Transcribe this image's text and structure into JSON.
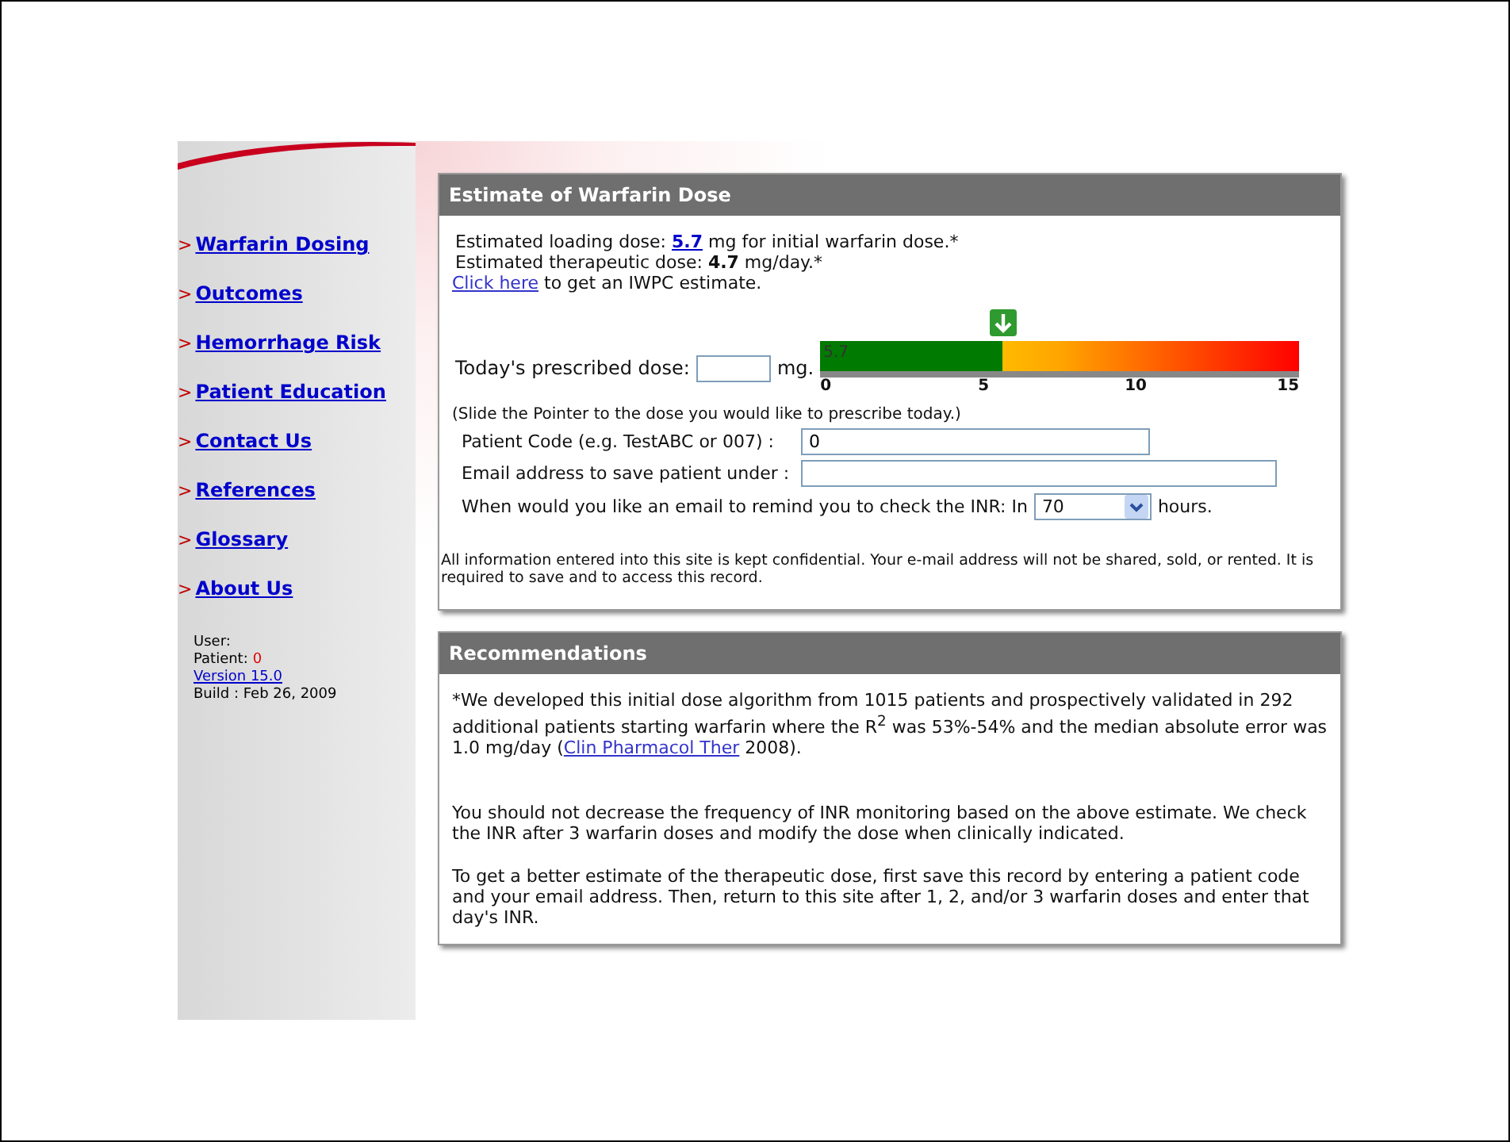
{
  "sidebar": {
    "items": [
      {
        "marker": ">",
        "label": "Warfarin Dosing"
      },
      {
        "marker": ">",
        "label": "Outcomes"
      },
      {
        "marker": ">",
        "label": "Hemorrhage Risk"
      },
      {
        "marker": ">",
        "label": "Patient Education"
      },
      {
        "marker": ">",
        "label": "Contact Us"
      },
      {
        "marker": ">",
        "label": "References"
      },
      {
        "marker": ">",
        "label": "Glossary"
      },
      {
        "marker": ">",
        "label": "About Us"
      }
    ],
    "info": {
      "user": "User:",
      "patient_label": "Patient:",
      "patient_value": "0",
      "version": "Version 15.0",
      "build": "Build : Feb 26, 2009"
    }
  },
  "estimate": {
    "title": "Estimate of Warfarin Dose",
    "loading_prefix": "Estimated loading dose:",
    "loading_value": "5.7",
    "loading_suffix": "mg for initial warfarin dose.*",
    "therapeutic": "Estimated therapeutic dose: **4.7** mg/day.*",
    "iwpc_link": "Click here",
    "iwpc_text": "to get an IWPC estimate.",
    "dose_label": "Today's prescribed dose:",
    "dose_unit": "mg.",
    "meter": {
      "level": 0.38,
      "reading": "5.7",
      "ticks": [
        "0",
        "5",
        "10",
        "15"
      ]
    },
    "hint": "(Slide the Pointer to the dose you would like to prescribe today.)",
    "patient_code_label": "Patient Code (e.g. TestABC or 007) :",
    "patient_code_value": "0",
    "email_label": "Email address to save patient under :",
    "remind_label": "When would you like an email to remind you to check the INR: In",
    "remind_value": "70",
    "remind_unit": "hours.",
    "privacy": "All information entered into this site is kept confidential. Your e-mail address will not be shared, sold, or rented. It is required to save and to access this record."
  },
  "recommendations": {
    "title": "Recommendations",
    "footnote_before": "*We developed this initial dose algorithm from 1015 patients and prospectively validated in 292 additional patients starting warfarin where the R$^{2}$ was 53%-54% and the median absolute error was 1.0 mg/day (",
    "footnote_link": "Clin Pharmacol Ther",
    "footnote_after": "2008).",
    "paragraphs": [
      "You should not decrease the frequency of INR monitoring based on the above estimate. We check the INR after 3 warfarin doses and modify the dose when clinically indicated.",
      "To get a better estimate of the therapeutic dose, first save this record by entering a patient code and your email address. Then, return to this site after 1, 2, and/or 3 warfarin doses and enter that day's INR."
    ]
  }
}
